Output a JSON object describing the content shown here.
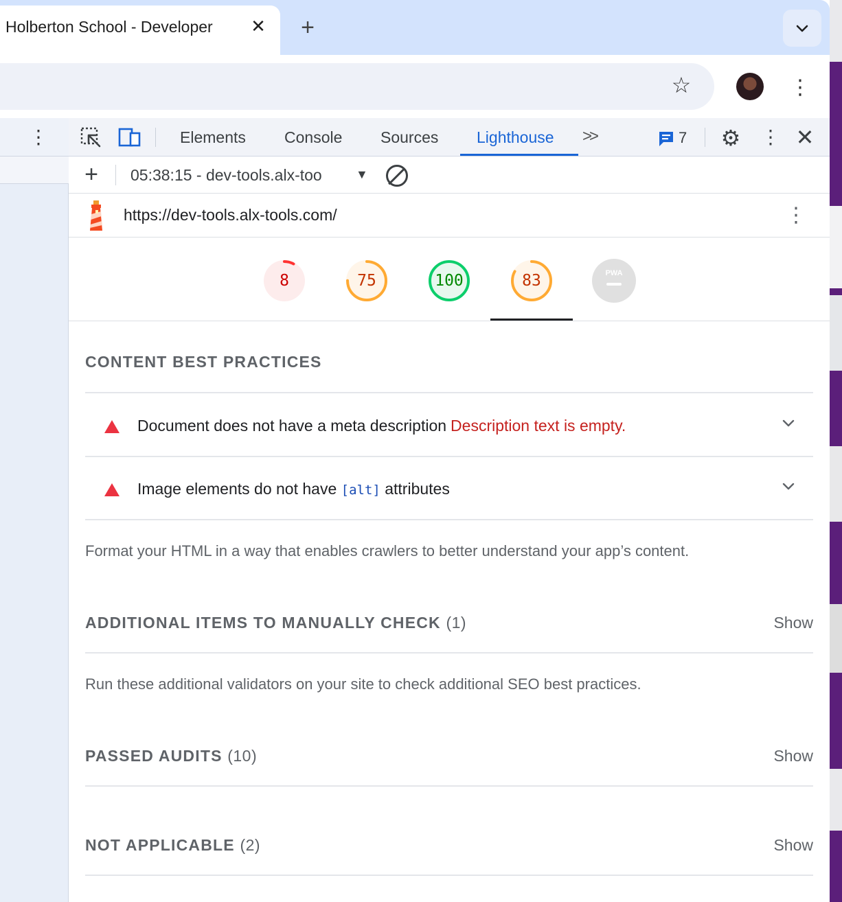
{
  "browser": {
    "tab_title": "Holberton School - Developer",
    "close_glyph": "✕",
    "new_tab_glyph": "+",
    "tab_search_glyph": "⌄",
    "star_glyph": "☆",
    "menu_glyph": "⋮"
  },
  "devtools": {
    "tabs": [
      "Elements",
      "Console",
      "Sources",
      "Lighthouse"
    ],
    "active_tab": "Lighthouse",
    "more_tabs_glyph": ">>",
    "issues_count": "7",
    "gear_glyph": "⚙",
    "close_glyph": "✕",
    "menu_glyph": "⋮"
  },
  "report_bar": {
    "add_glyph": "+",
    "selected_report": "05:38:15 - dev-tools.alx-too",
    "caret_glyph": "▼"
  },
  "report": {
    "url": "https://dev-tools.alx-tools.com/",
    "scores": [
      {
        "value": "8",
        "fraction": 0.08,
        "status": "fail",
        "color": "#cc0000",
        "ring": "#ff3333",
        "fill": "#fdecec"
      },
      {
        "value": "75",
        "fraction": 0.75,
        "status": "average",
        "color": "#c33300",
        "ring": "#ffaa33",
        "fill": "#fff5e9"
      },
      {
        "value": "100",
        "fraction": 1.0,
        "status": "pass",
        "color": "#008800",
        "ring": "#0cce6b",
        "fill": "#e7f8ee"
      },
      {
        "value": "83",
        "fraction": 0.83,
        "status": "average",
        "color": "#c33300",
        "ring": "#ffaa33",
        "fill": "#fff5e9"
      }
    ],
    "pwa_badge": "PWA"
  },
  "content": {
    "section_title": "CONTENT BEST PRACTICES",
    "audits": [
      {
        "text": "Document does not have a meta description",
        "error": "Description text is empty."
      },
      {
        "text_before": "Image elements do not have",
        "code": "[alt]",
        "text_after": "attributes"
      }
    ],
    "section_description": "Format your HTML in a way that enables crawlers to better understand your app’s content.",
    "manual": {
      "title": "ADDITIONAL ITEMS TO MANUALLY CHECK",
      "count": "(1)",
      "show": "Show",
      "description": "Run these additional validators on your site to check additional SEO best practices."
    },
    "passed": {
      "title": "PASSED AUDITS",
      "count": "(10)",
      "show": "Show"
    },
    "not_applicable": {
      "title": "NOT APPLICABLE",
      "count": "(2)",
      "show": "Show"
    }
  },
  "colors": {
    "accent": "#1a65d6",
    "fail": "#eb3341",
    "error_text": "#c5221f"
  }
}
